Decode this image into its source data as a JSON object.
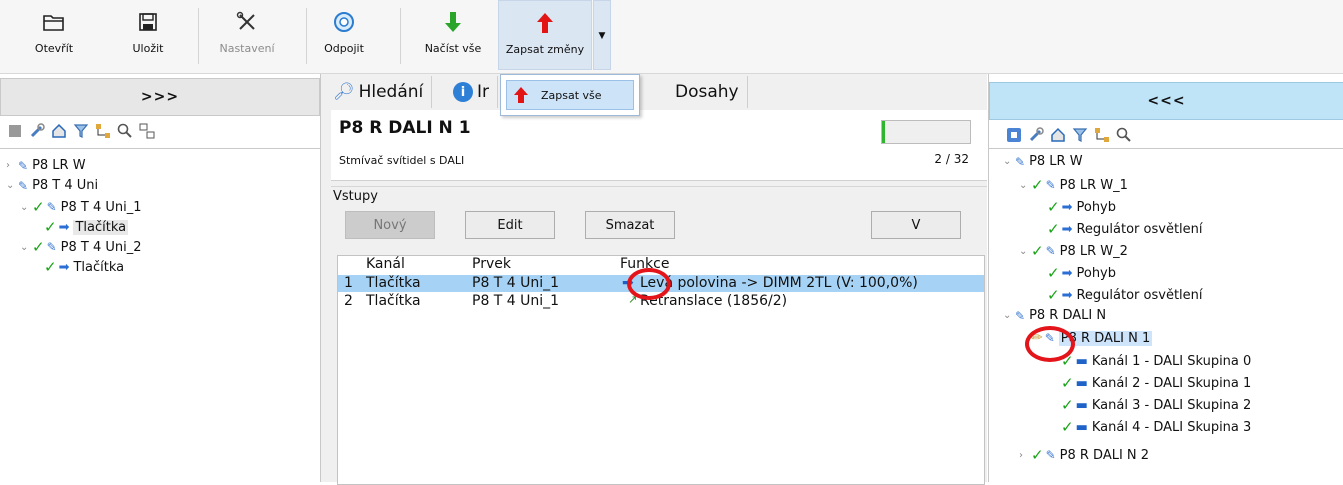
{
  "toolbar": {
    "open": "Otevřít",
    "save": "Uložit",
    "settings": "Nastavení",
    "disconnect": "Odpojit",
    "read_all": "Načíst vše",
    "write_changes": "Zapsat změny"
  },
  "dropdown": {
    "write_all": "Zapsat vše"
  },
  "left": {
    "toggle": ">>>",
    "tree": [
      {
        "label": "P8 LR W"
      },
      {
        "label": "P8 T 4 Uni"
      },
      {
        "label": "P8 T 4 Uni_1"
      },
      {
        "label": "Tlačítka"
      },
      {
        "label": "P8 T 4 Uni_2"
      },
      {
        "label": "Tlačítka"
      }
    ]
  },
  "tabs": [
    {
      "label": "Hledání"
    },
    {
      "label": "Ir"
    },
    {
      "label": "Dosahy"
    }
  ],
  "device": {
    "title": "P8 R DALI N 1",
    "subtitle": "Stmívač svítidel s DALI",
    "count": "2 / 32",
    "progress": 0.02
  },
  "inputs": {
    "group_label": "Vstupy",
    "btn_new": "Nový",
    "btn_edit": "Edit",
    "btn_delete": "Smazat",
    "btn_v": "V",
    "columns": {
      "channel": "Kanál",
      "element": "Prvek",
      "function": "Funkce"
    },
    "rows": [
      {
        "num": "1",
        "channel": "Tlačítka",
        "element": "P8 T 4 Uni_1",
        "function": "Levá polovina -> DIMM 2TL (V: 100,0%)"
      },
      {
        "num": "2",
        "channel": "Tlačítka",
        "element": "P8 T 4 Uni_1",
        "function": "Retranslace (1856/2)"
      }
    ]
  },
  "right": {
    "toggle": "<<<",
    "tree": [
      {
        "label": "P8 LR W"
      },
      {
        "label": "P8 LR W_1"
      },
      {
        "label": "Pohyb"
      },
      {
        "label": "Regulátor osvětlení"
      },
      {
        "label": "P8 LR W_2"
      },
      {
        "label": "Pohyb"
      },
      {
        "label": "Regulátor osvětlení"
      },
      {
        "label": "P8 R DALI N"
      },
      {
        "label": "P8 R DALI N 1"
      },
      {
        "label": "Kanál 1 - DALI Skupina 0"
      },
      {
        "label": "Kanál 2 - DALI Skupina 1"
      },
      {
        "label": "Kanál 3 - DALI Skupina 2"
      },
      {
        "label": "Kanál 4 - DALI Skupina 3"
      },
      {
        "label": "P8 R DALI N 2"
      }
    ]
  },
  "colors": {
    "accent_red": "#e3141a",
    "check_green": "#19a319",
    "select_blue": "#a6d3f5",
    "toggle_right": "#bfe3f7"
  }
}
